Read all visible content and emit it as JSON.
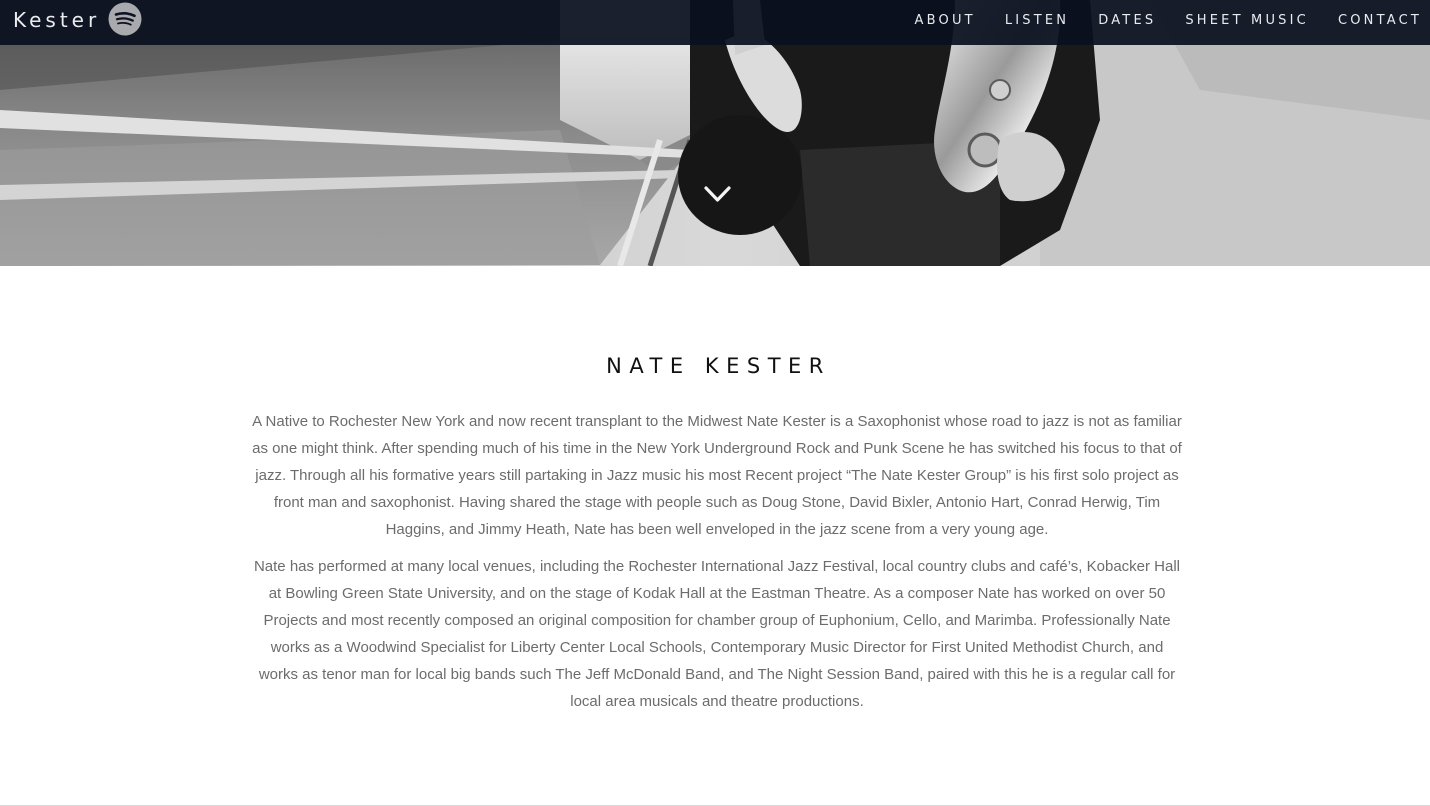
{
  "brand": {
    "name": "Kester",
    "streaming_icon": "spotify-icon"
  },
  "nav": {
    "items": [
      {
        "label": "ABOUT"
      },
      {
        "label": "LISTEN"
      },
      {
        "label": "DATES"
      },
      {
        "label": "SHEET MUSIC"
      },
      {
        "label": "CONTACT"
      }
    ]
  },
  "hero": {
    "scroll_icon": "chevron-down-icon"
  },
  "about": {
    "title": "NATE KESTER",
    "paragraphs": [
      "A Native to Rochester New York and now recent transplant to the Midwest Nate Kester is a Saxophonist whose road to jazz is not as familiar as one might think. After spending much of his time in the New York Underground Rock and Punk Scene he has switched his focus to that of jazz. Through all his formative years still partaking in Jazz music his most Recent project “The Nate Kester Group” is his first solo project as front man and saxophonist. Having shared the stage with people such as Doug Stone, David Bixler, Antonio Hart, Conrad Herwig, Tim Haggins, and Jimmy Heath, Nate has been well enveloped in the jazz scene from a very young age.",
      "Nate has performed at many local venues, including the Rochester International Jazz Festival, local country clubs and café’s, Kobacker Hall at Bowling Green State University, and on the stage of Kodak Hall at the Eastman Theatre. As a composer Nate has worked on over 50 Projects and most recently composed an original composition for chamber group of Euphonium, Cello, and Marimba. Professionally Nate works as a Woodwind Specialist for Liberty Center Local Schools, Contemporary Music Director for First United Methodist Church, and works as tenor man for local big bands such The Jeff McDonald Band, and The Night Session Band, paired with this he is a regular call for local area musicals and theatre productions."
    ]
  },
  "colors": {
    "nav_bg": "#0a101e",
    "nav_text": "#e9ebef",
    "heading": "#111111",
    "body_text": "#6c6c6c"
  }
}
